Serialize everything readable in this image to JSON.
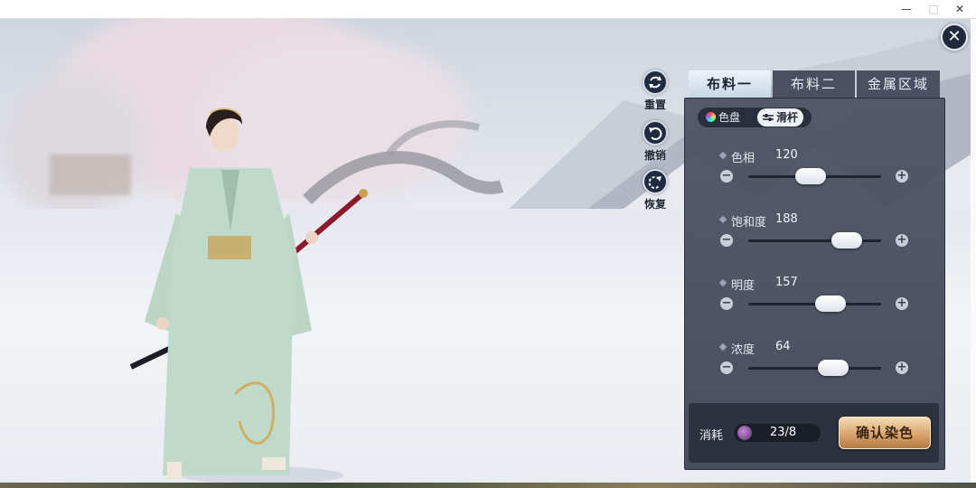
{
  "window": {
    "minimize_glyph": "—",
    "maximize_glyph": "□",
    "close_glyph": "✕"
  },
  "close_button": {
    "glyph": "✕"
  },
  "actions": [
    {
      "label": "重置",
      "icon": "reset-icon"
    },
    {
      "label": "撤销",
      "icon": "undo-icon"
    },
    {
      "label": "恢复",
      "icon": "redo-icon"
    }
  ],
  "tabs": [
    {
      "label": "布料一",
      "active": true
    },
    {
      "label": "布料二",
      "active": false
    },
    {
      "label": "金属区域",
      "active": false
    }
  ],
  "mode_toggle": {
    "palette_label": "色盘",
    "slider_label": "滑杆",
    "active": "slider"
  },
  "sliders": [
    {
      "label": "色相",
      "value": "120",
      "fraction": 0.47
    },
    {
      "label": "饱和度",
      "value": "188",
      "fraction": 0.74
    },
    {
      "label": "明度",
      "value": "157",
      "fraction": 0.62
    },
    {
      "label": "浓度",
      "value": "64",
      "fraction": 0.64
    }
  ],
  "stepper": {
    "minus": "−",
    "plus": "+"
  },
  "cost": {
    "label": "消耗",
    "value": "23/8",
    "icon": "dye-item-icon"
  },
  "confirm": {
    "label": "确认染色"
  },
  "colors": {
    "panel_bg": "#4e5464",
    "active_tab": "#dbe6f1",
    "confirm_gold": "#d9a56c",
    "robe": "#bfd9c9"
  }
}
